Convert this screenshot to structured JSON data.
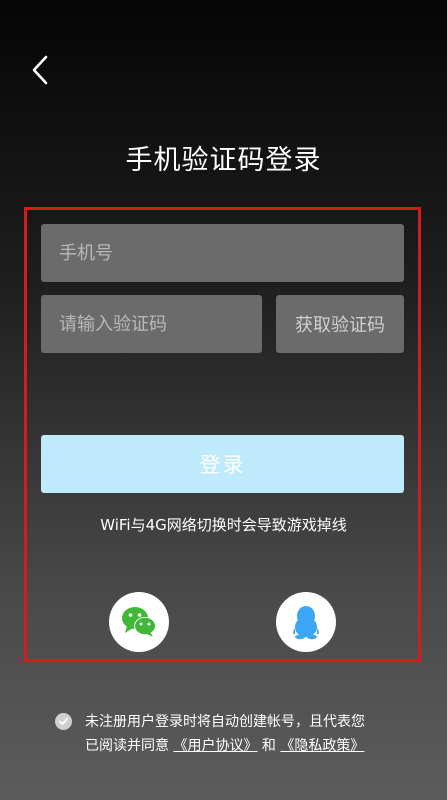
{
  "header": {
    "back_icon": "chevron-left-icon",
    "title": "手机验证码登录"
  },
  "form": {
    "phone_placeholder": "手机号",
    "code_placeholder": "请输入验证码",
    "get_code_label": "获取验证码",
    "login_label": "登录",
    "warning": "WiFi与4G网络切换时会导致游戏掉线",
    "accent_color": "#bfeafc",
    "highlight_border_color": "#d71a1a"
  },
  "social": [
    {
      "name": "wechat",
      "icon": "wechat-icon",
      "color": "#3fb838"
    },
    {
      "name": "qq",
      "icon": "qq-penguin-icon",
      "color": "#3ba6f5"
    }
  ],
  "agreement": {
    "line1": "未注册用户登录时将自动创建帐号，且代表您",
    "prefix": "已阅读并同意",
    "user_agreement": "《用户协议》",
    "and": "和",
    "privacy_policy": "《隐私政策》"
  }
}
